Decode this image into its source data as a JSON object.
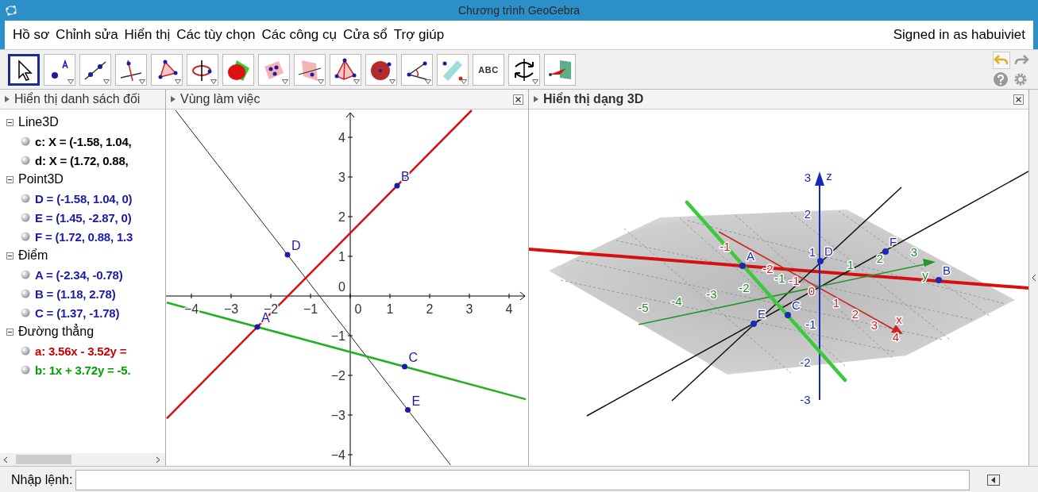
{
  "window": {
    "title": "Chương trình GeoGebra"
  },
  "menu": {
    "items": [
      "Hồ sơ",
      "Chỉnh sửa",
      "Hiển thị",
      "Các tùy chọn",
      "Các công cụ",
      "Cửa sổ",
      "Trợ giúp"
    ],
    "account": "Signed in as habuiviet"
  },
  "toolbar": {
    "tools": [
      {
        "kind": "move",
        "selected": true,
        "menu": false
      },
      {
        "kind": "point",
        "selected": false,
        "menu": true
      },
      {
        "kind": "line",
        "selected": false,
        "menu": true
      },
      {
        "kind": "perpendicular",
        "selected": false,
        "menu": true
      },
      {
        "kind": "polygon",
        "selected": false,
        "menu": true
      },
      {
        "kind": "ellipse",
        "selected": false,
        "menu": true
      },
      {
        "kind": "intersect",
        "selected": false,
        "menu": false
      },
      {
        "kind": "plane_points",
        "selected": false,
        "menu": true
      },
      {
        "kind": "plane",
        "selected": false,
        "menu": true
      },
      {
        "kind": "pyramid",
        "selected": false,
        "menu": true
      },
      {
        "kind": "sphere",
        "selected": false,
        "menu": true
      },
      {
        "kind": "angle",
        "selected": false,
        "menu": true
      },
      {
        "kind": "reflect",
        "selected": false,
        "menu": true
      },
      {
        "kind": "text",
        "label": "ABC",
        "selected": false,
        "menu": false
      },
      {
        "kind": "rotate",
        "selected": false,
        "menu": true
      },
      {
        "kind": "view",
        "selected": false,
        "menu": false
      }
    ]
  },
  "algebra_view": {
    "title": "Hiển thị danh sách đối",
    "focused": false,
    "groups": [
      {
        "name": "Line3D",
        "expanded": true,
        "items": [
          {
            "text": "c: X = (-1.58, 1.04,",
            "color": "#000000"
          },
          {
            "text": "d: X = (1.72, 0.88,",
            "color": "#000000"
          }
        ]
      },
      {
        "name": "Point3D",
        "expanded": true,
        "items": [
          {
            "text": "D = (-1.58, 1.04, 0)",
            "color": "#1a1aa6"
          },
          {
            "text": "E = (1.45, -2.87, 0)",
            "color": "#1a1aa6"
          },
          {
            "text": "F = (1.72, 0.88, 1.3",
            "color": "#1a1aa6"
          }
        ]
      },
      {
        "name": "Điểm",
        "expanded": true,
        "items": [
          {
            "text": "A = (-2.34, -0.78)",
            "color": "#1a1aa6"
          },
          {
            "text": "B = (1.18, 2.78)",
            "color": "#1a1aa6"
          },
          {
            "text": "C = (1.37, -1.78)",
            "color": "#1a1aa6"
          }
        ]
      },
      {
        "name": "Đường thẳng",
        "expanded": true,
        "items": [
          {
            "text": "a: 3.56x - 3.52y =",
            "color": "#cc0000"
          },
          {
            "text": "b: 1x + 3.72y = -5.",
            "color": "#00a000"
          }
        ]
      }
    ]
  },
  "graphics_view": {
    "title": "Vùng làm việc",
    "focused": false,
    "x_tick_labels": [
      "−4",
      "−3",
      "−2",
      "−1",
      "0",
      "1",
      "2",
      "3",
      "4"
    ],
    "y_tick_labels": [
      "4",
      "3",
      "2",
      "1",
      "0",
      "−1",
      "−2",
      "−3",
      "−4"
    ],
    "point_labels": [
      "D",
      "B",
      "A",
      "C",
      "E"
    ]
  },
  "view_3d": {
    "title": "Hiển thị dạng 3D",
    "focused": true,
    "x_axis_labels": [
      "-1",
      "-2",
      "-1",
      "0",
      "1",
      "2",
      "3",
      "4",
      "x"
    ],
    "y_axis_labels": [
      "-5",
      "-4",
      "-3",
      "-2",
      "-1",
      "1",
      "2",
      "3",
      "y"
    ],
    "z_axis_labels": [
      "3",
      "2",
      "1",
      "-1",
      "-2",
      "-3",
      "z"
    ],
    "point_labels": [
      "A",
      "D",
      "F",
      "B",
      "E",
      "C"
    ]
  },
  "input_bar": {
    "label": "Nhập lệnh:"
  }
}
